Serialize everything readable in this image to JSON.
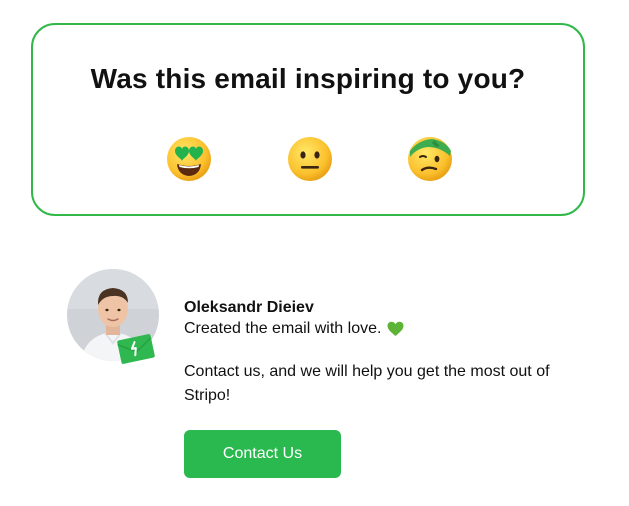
{
  "survey": {
    "title": "Was this email inspiring to you?",
    "options": [
      {
        "icon": "heart-eyes-face-icon"
      },
      {
        "icon": "neutral-face-icon"
      },
      {
        "icon": "bandaged-face-icon"
      }
    ],
    "border_color": "#31b848"
  },
  "signature": {
    "name": "Oleksandr Dieiev",
    "note": "Created the email with love.",
    "note_icon": "green-heart-icon",
    "message": "Contact us, and we will help you get the most out of Stripo!",
    "button_label": "Contact Us",
    "button_color": "#2ab94e"
  },
  "avatar": {
    "icon": "avatar",
    "badge_icon": "stripo-badge-icon"
  }
}
